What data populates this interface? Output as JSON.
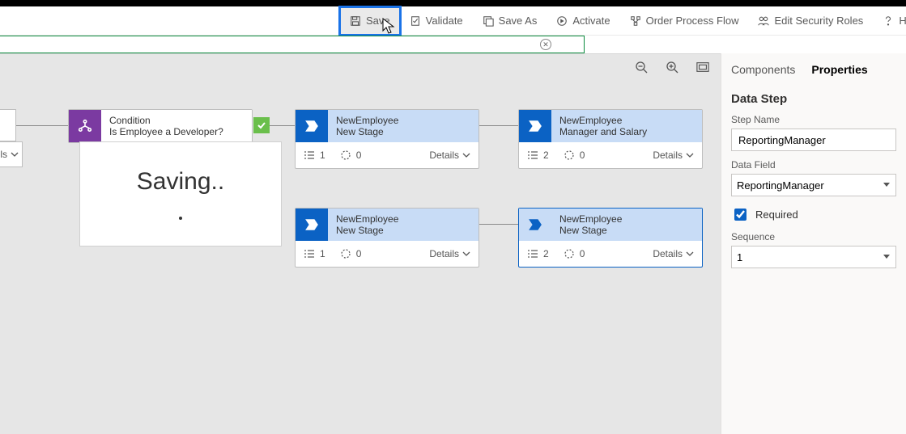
{
  "toolbar": {
    "save": "Save",
    "validate": "Validate",
    "saveas": "Save As",
    "activate": "Activate",
    "orderflow": "Order Process Flow",
    "security": "Edit Security Roles",
    "help": "Help"
  },
  "saving_overlay": {
    "text": "Saving.."
  },
  "canvas": {
    "partial_foot": "ils",
    "condition": {
      "t1": "Condition",
      "t2": "Is Employee a Developer?"
    },
    "stage1": {
      "t1": "NewEmployee",
      "t2": "New Stage",
      "count": "1",
      "zero": "0",
      "details": "Details"
    },
    "stage2": {
      "t1": "NewEmployee",
      "t2": "Manager and Salary",
      "count": "2",
      "zero": "0",
      "details": "Details"
    },
    "stage3": {
      "t1": "NewEmployee",
      "t2": "New Stage",
      "count": "1",
      "zero": "0",
      "details": "Details"
    },
    "stage4": {
      "t1": "NewEmployee",
      "t2": "New Stage",
      "count": "2",
      "zero": "0",
      "details": "Details"
    }
  },
  "panel": {
    "tab_components": "Components",
    "tab_properties": "Properties",
    "section": "Data Step",
    "step_name_lbl": "Step Name",
    "step_name_val": "ReportingManager",
    "data_field_lbl": "Data Field",
    "data_field_val": "ReportingManager",
    "required_lbl": "Required",
    "sequence_lbl": "Sequence",
    "sequence_val": "1"
  }
}
